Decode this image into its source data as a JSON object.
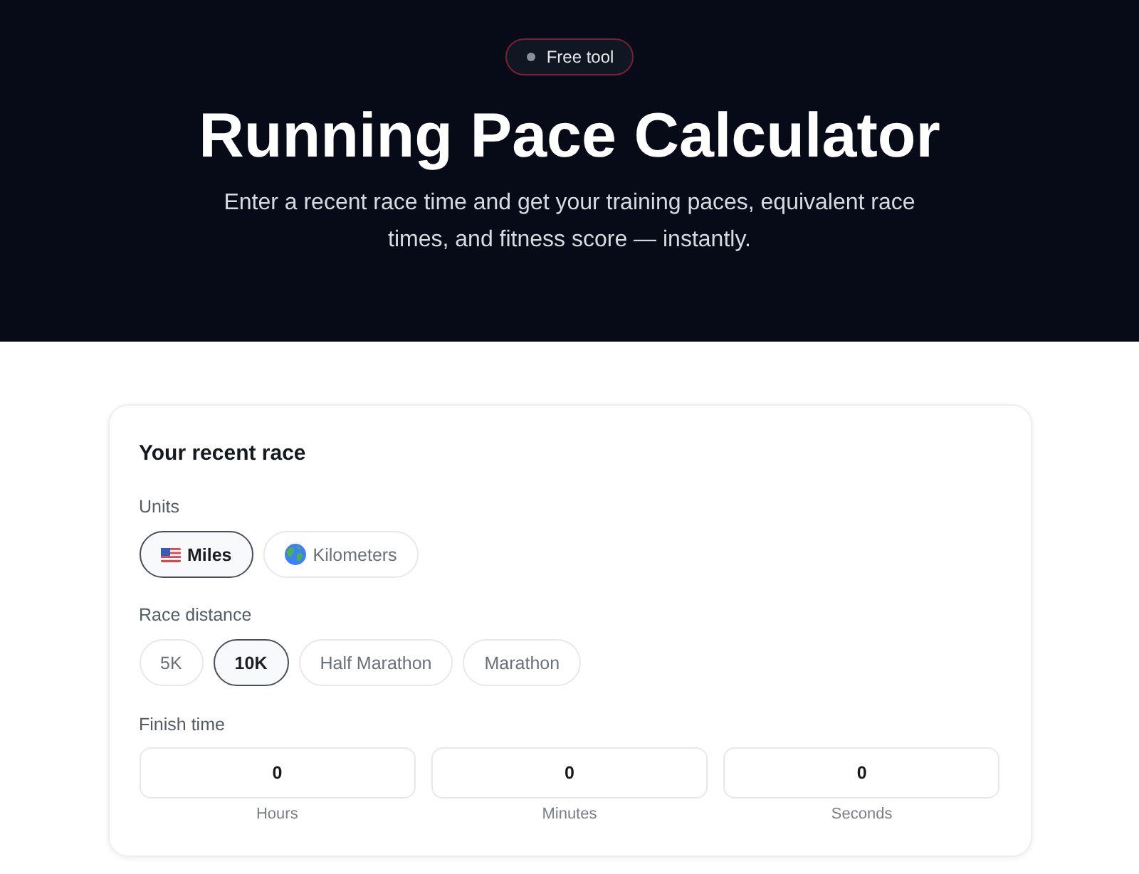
{
  "hero": {
    "badge": "Free tool",
    "title": "Running Pace Calculator",
    "subtitle": "Enter a recent race time and get your training paces, equivalent race times, and fitness score — instantly."
  },
  "card": {
    "title": "Your recent race",
    "units": {
      "label": "Units",
      "options": [
        {
          "label": "Miles",
          "selected": true
        },
        {
          "label": "Kilometers",
          "selected": false
        }
      ]
    },
    "distance": {
      "label": "Race distance",
      "options": [
        {
          "label": "5K",
          "selected": false
        },
        {
          "label": "10K",
          "selected": true
        },
        {
          "label": "Half Marathon",
          "selected": false
        },
        {
          "label": "Marathon",
          "selected": false
        }
      ]
    },
    "finish_time": {
      "label": "Finish time",
      "fields": [
        {
          "value": "0",
          "caption": "Hours"
        },
        {
          "value": "0",
          "caption": "Minutes"
        },
        {
          "value": "0",
          "caption": "Seconds"
        }
      ]
    }
  }
}
